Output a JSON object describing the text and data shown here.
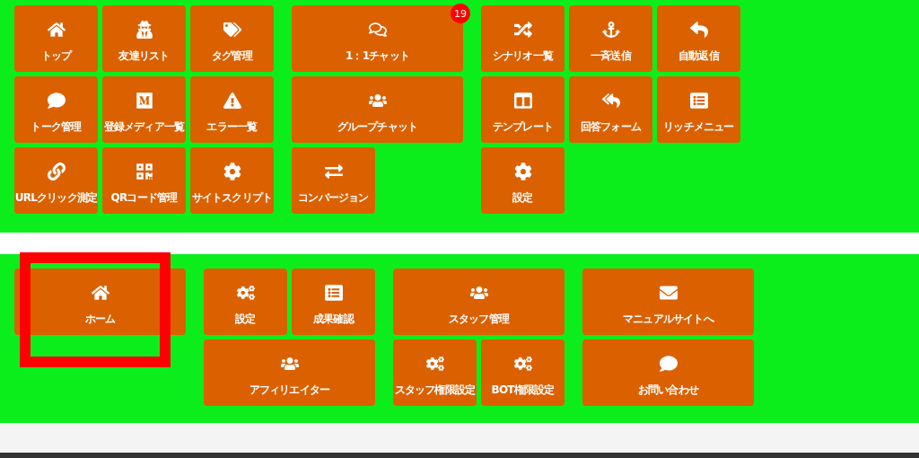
{
  "sections": [
    {
      "groups": [
        {
          "rows": [
            [
              {
                "label": "トップ",
                "kind": "small"
              },
              {
                "label": "友達リスト",
                "kind": "small"
              },
              {
                "label": "タグ管理",
                "kind": "small"
              }
            ],
            [
              {
                "label": "トーク管理",
                "kind": "small"
              },
              {
                "label": "登録メディア一覧",
                "kind": "small"
              },
              {
                "label": "エラー一覧",
                "kind": "small"
              }
            ],
            [
              {
                "label": "URLクリック測定",
                "kind": "small"
              },
              {
                "label": "QRコード管理",
                "kind": "small"
              },
              {
                "label": "サイトスクリプト",
                "kind": "small"
              }
            ]
          ]
        },
        {
          "rows": [
            [
              {
                "label": "1：1チャット",
                "kind": "wide",
                "badge": "19"
              }
            ],
            [
              {
                "label": "グループチャット",
                "kind": "wide"
              }
            ],
            [
              {
                "label": "コンバージョン",
                "kind": "small"
              }
            ]
          ]
        },
        {
          "rows": [
            [
              {
                "label": "シナリオ一覧",
                "kind": "small"
              },
              {
                "label": "一斉送信",
                "kind": "small"
              },
              {
                "label": "自動返信",
                "kind": "small"
              }
            ],
            [
              {
                "label": "テンプレート",
                "kind": "small"
              },
              {
                "label": "回答フォーム",
                "kind": "small"
              },
              {
                "label": "リッチメニュー",
                "kind": "small"
              }
            ],
            [
              {
                "label": "設定",
                "kind": "small"
              }
            ]
          ]
        }
      ]
    },
    {
      "groups": [
        {
          "rows": [
            [
              {
                "label": "ホーム",
                "kind": "wide",
                "highlighted": true
              }
            ]
          ]
        },
        {
          "rows": [
            [
              {
                "label": "設定",
                "kind": "small"
              },
              {
                "label": "成果確認",
                "kind": "small"
              }
            ],
            [
              {
                "label": "アフィリエイター",
                "kind": "wide"
              }
            ]
          ]
        },
        {
          "rows": [
            [
              {
                "label": "スタッフ管理",
                "kind": "wide"
              }
            ],
            [
              {
                "label": "スタッフ権限設定",
                "kind": "small"
              },
              {
                "label": "BOT権限設定",
                "kind": "small"
              }
            ]
          ]
        },
        {
          "rows": [
            [
              {
                "label": "マニュアルサイトへ",
                "kind": "wide"
              }
            ],
            [
              {
                "label": "お問い合わせ",
                "kind": "wide"
              }
            ]
          ]
        }
      ]
    }
  ]
}
